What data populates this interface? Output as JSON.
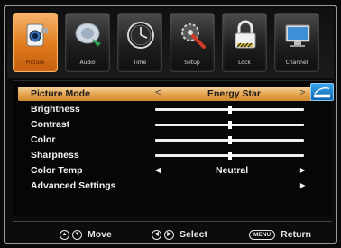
{
  "tabs": [
    {
      "label": "Picture",
      "icon": "camcorder-icon",
      "active": true
    },
    {
      "label": "Audio",
      "icon": "satellite-dish-icon",
      "active": false
    },
    {
      "label": "Time",
      "icon": "clock-icon",
      "active": false
    },
    {
      "label": "Setup",
      "icon": "wrench-gear-icon",
      "active": false
    },
    {
      "label": "Lock",
      "icon": "padlock-icon",
      "active": false
    },
    {
      "label": "Channel",
      "icon": "monitor-icon",
      "active": false
    }
  ],
  "menu": {
    "picture_mode": {
      "label": "Picture Mode",
      "value": "Energy Star"
    },
    "brightness": {
      "label": "Brightness",
      "level": 0.5
    },
    "contrast": {
      "label": "Contrast",
      "level": 0.5
    },
    "color": {
      "label": "Color",
      "level": 0.5
    },
    "sharpness": {
      "label": "Sharpness",
      "level": 0.5
    },
    "color_temp": {
      "label": "Color Temp",
      "value": "Neutral"
    },
    "advanced": {
      "label": "Advanced Settings"
    }
  },
  "help": {
    "move": "Move",
    "select": "Select",
    "menu_key": "MENU",
    "return": "Return"
  },
  "colors": {
    "accent": "#e07a1c",
    "selected_row": "#e4a24a",
    "badge": "#1067b4"
  }
}
